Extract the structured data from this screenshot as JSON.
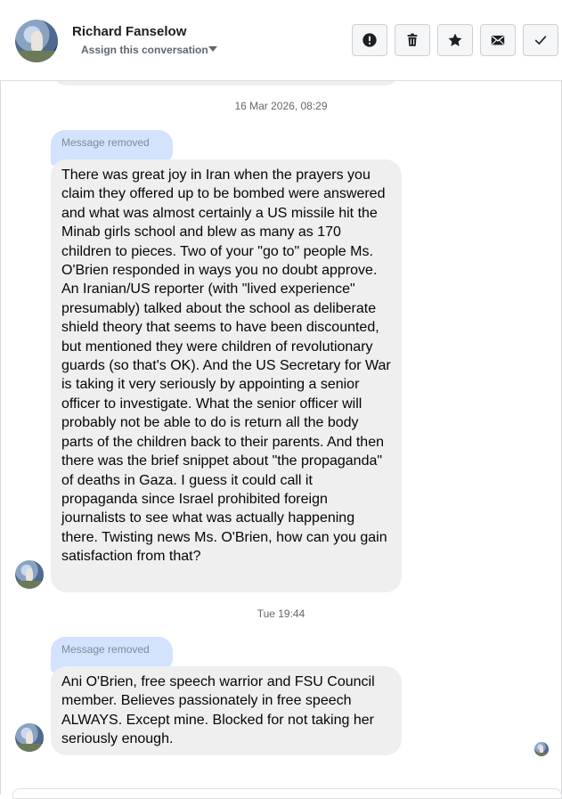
{
  "header": {
    "contact_name": "Richard Fanselow",
    "assign_label": "Assign this conversation",
    "actions": [
      {
        "name": "spam",
        "icon": "alert-circle-icon"
      },
      {
        "name": "delete",
        "icon": "trash-icon"
      },
      {
        "name": "star",
        "icon": "star-icon"
      },
      {
        "name": "mark-unread",
        "icon": "envelope-icon"
      },
      {
        "name": "done",
        "icon": "checkmark-icon"
      }
    ]
  },
  "thread": {
    "timestamp_1": "16 Mar 2026, 08:29",
    "removed_label_1": "Message removed",
    "message_1": "There was great joy in Iran when the prayers you claim they offered up to be bombed were answered and what was almost certainly a US missile hit the Minab girls school and blew as many as 170 children to pieces. Two of your \"go to\" people Ms. O'Brien responded in ways you no doubt approve. An Iranian/US reporter (with \"lived experience\" presumably) talked about the school as deliberate shield theory that seems to have been discounted, but mentioned they were children of revolutionary guards (so that's OK). And the US Secretary for War is taking it very seriously by appointing a senior officer to investigate. What the senior officer will probably not be able to do is return all the body parts of the children back to their parents. And then there was the brief snippet about \"the propaganda\" of deaths in Gaza. I guess it could call it propaganda since Israel prohibited foreign journalists to see what was actually happening there. Twisting news Ms. O'Brien, how can you gain satisfaction from that?",
    "timestamp_2": "Tue 19:44",
    "removed_label_2": "Message removed",
    "message_2": "Ani O'Brien, free speech warrior and FSU Council member. Believes passionately in free speech ALWAYS. Except mine. Blocked for not taking her seriously enough."
  },
  "colors": {
    "incoming_bubble": "#efefef",
    "removed_bubble": "#d3e3fd",
    "secondary_text": "#65676b",
    "button_bg": "#f5f6f7"
  }
}
